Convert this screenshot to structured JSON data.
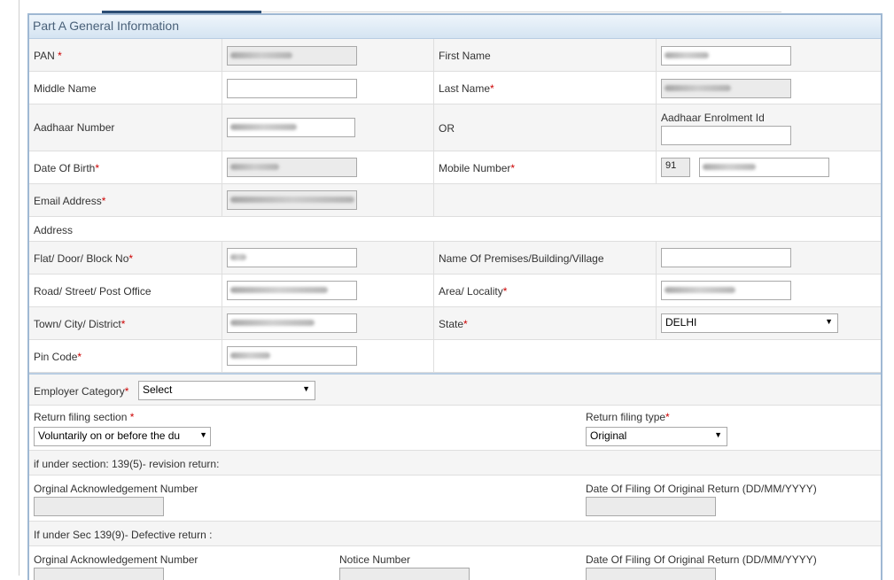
{
  "panel": {
    "title": "Part A General Information"
  },
  "fields": {
    "pan": {
      "label": "PAN",
      "req": "*"
    },
    "first_name": {
      "label": "First Name",
      "req": ""
    },
    "middle_name": {
      "label": "Middle Name",
      "req": ""
    },
    "last_name": {
      "label": "Last Name",
      "req": "*"
    },
    "aadhaar": {
      "label": "Aadhaar Number",
      "req": ""
    },
    "or": {
      "label": "OR"
    },
    "aadhaar_enrol": {
      "label": "Aadhaar Enrolment Id"
    },
    "dob": {
      "label": "Date Of Birth",
      "req": "*"
    },
    "mobile": {
      "label": "Mobile Number",
      "req": "*",
      "country_code": "91"
    },
    "email": {
      "label": "Email Address",
      "req": "*"
    },
    "address": {
      "label": "Address"
    },
    "flat": {
      "label": "Flat/ Door/ Block No",
      "req": "*"
    },
    "premises": {
      "label": "Name Of Premises/Building/Village",
      "req": ""
    },
    "road": {
      "label": "Road/ Street/ Post Office",
      "req": ""
    },
    "area": {
      "label": "Area/ Locality",
      "req": "*"
    },
    "town": {
      "label": "Town/ City/ District",
      "req": "*"
    },
    "state": {
      "label": "State",
      "req": "*",
      "value": "DELHI"
    },
    "pin": {
      "label": "Pin Code",
      "req": "*"
    }
  },
  "filing": {
    "employer_category": {
      "label": "Employer Category",
      "req": "*",
      "value": "Select"
    },
    "return_section": {
      "label": "Return filing section ",
      "req": "*",
      "value": "Voluntarily on or before the du"
    },
    "return_type": {
      "label": "Return filing type",
      "req": "*",
      "value": "Original"
    },
    "revision_note": "if under section: 139(5)- revision return:",
    "orig_ack": "Orginal Acknowledgement Number",
    "orig_date": "Date Of Filing Of Original Return (DD/MM/YYYY)",
    "defective_note": "If under Sec 139(9)- Defective return :",
    "orig_ack2": "Orginal Acknowledgement Number",
    "notice_number": "Notice Number",
    "orig_date2": "Date Of Filing Of Original Return (DD/MM/YYYY)"
  },
  "colors": {
    "required": "#cc0000",
    "header_border": "#9fb8d3",
    "title": "#4a6179"
  }
}
